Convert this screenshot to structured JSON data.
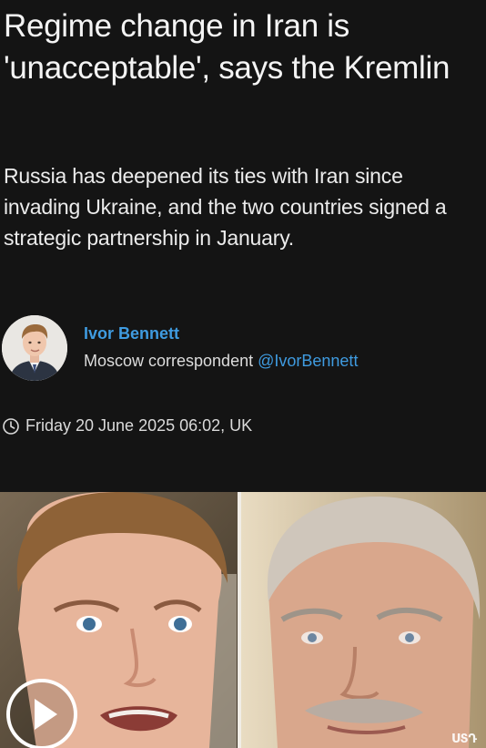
{
  "article": {
    "headline": "Regime change in Iran is 'unacceptable', says the Kremlin",
    "standfirst": "Russia has deepened its ties with Iran since invading Ukraine, and the two countries signed a strategic partnership in January."
  },
  "author": {
    "name": "Ivor Bennett",
    "role": "Moscow correspondent",
    "handle": "@IvorBennett",
    "avatar_icon": "author-avatar"
  },
  "dateline": {
    "icon": "clock-icon",
    "text": "Friday 20 June 2025 06:02, UK"
  },
  "media": {
    "play_icon": "play-icon",
    "watermark": "ՍՏԴ"
  },
  "colors": {
    "background": "#141414",
    "text": "#f2f2f2",
    "link": "#3f9be0"
  }
}
